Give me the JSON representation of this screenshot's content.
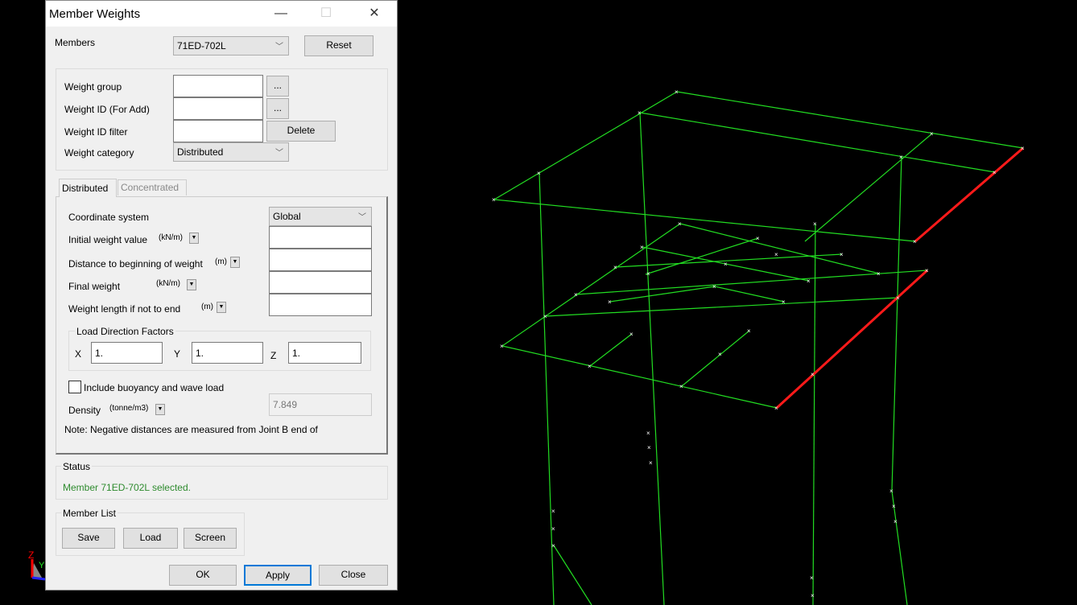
{
  "title": "Member Weights",
  "members": {
    "label": "Members",
    "value": "71ED-702L",
    "reset": "Reset"
  },
  "weight_group": {
    "label": "Weight group",
    "value": "",
    "browse": "..."
  },
  "weight_id": {
    "label": "Weight ID (For Add)",
    "value": "",
    "browse": "..."
  },
  "weight_filter": {
    "label": "Weight ID filter",
    "value": "",
    "delete": "Delete"
  },
  "weight_category": {
    "label": "Weight category",
    "value": "Distributed"
  },
  "tabs": [
    {
      "label": "Distributed",
      "active": true
    },
    {
      "label": "Concentrated",
      "active": false
    }
  ],
  "distributed": {
    "coord": {
      "label": "Coordinate system",
      "value": "Global"
    },
    "initial": {
      "label": "Initial weight value",
      "unit": "(kN/m)",
      "value": ""
    },
    "distance": {
      "label": "Distance to beginning of weight",
      "unit": "(m)",
      "value": ""
    },
    "final": {
      "label": "Final weight",
      "unit": "(kN/m)",
      "value": ""
    },
    "length": {
      "label": "Weight length if not to end",
      "unit": "(m)",
      "value": ""
    },
    "ldf": {
      "label": "Load Direction Factors",
      "x_label": "X",
      "x": "1.",
      "y_label": "Y",
      "y": "1.",
      "z_label": "Z",
      "z": "1."
    },
    "buoyancy": {
      "label": "Include buoyancy and wave load",
      "checked": false
    },
    "density": {
      "label": "Density",
      "unit": "(tonne/m3)",
      "value": "7.849"
    },
    "note": "Note: Negative distances are measured from Joint B end of"
  },
  "status": {
    "label": "Status",
    "text": "Member 71ED-702L selected.",
    "color": "#2e8b2e"
  },
  "member_list": {
    "label": "Member List",
    "save": "Save",
    "load": "Load",
    "screen": "Screen"
  },
  "footer": {
    "ok": "OK",
    "apply": "Apply",
    "close": "Close"
  },
  "axes": {
    "z": "Z",
    "y": "Y"
  },
  "colors": {
    "frame": "#22dd22",
    "selected": "#ff1a1a",
    "background": "#000000"
  }
}
